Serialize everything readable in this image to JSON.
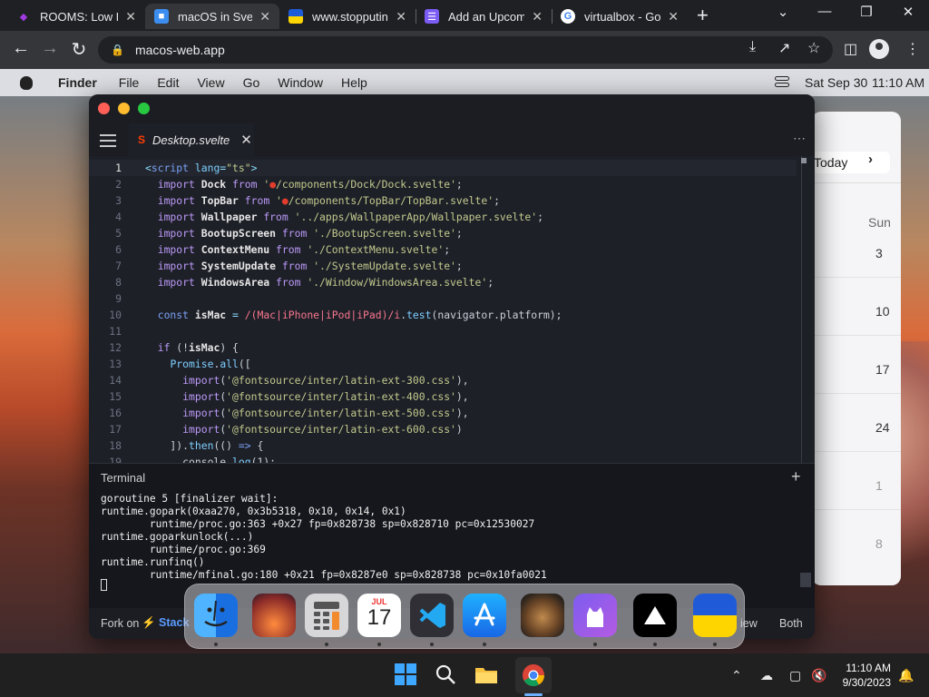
{
  "browser": {
    "tabs": [
      {
        "title": "ROOMS: Low De",
        "favicon": "rooms-icon",
        "color": "#a03be0"
      },
      {
        "title": "macOS in Svelte",
        "favicon": "vscode-file-icon",
        "color": "#3b8ef0"
      },
      {
        "title": "www.stopputin.",
        "favicon": "ukraine-icon",
        "color": "#ffd500"
      },
      {
        "title": "Add an Upcomi",
        "favicon": "form-icon",
        "color": "#7b5cf5"
      },
      {
        "title": "virtualbox - Goo",
        "favicon": "google-icon",
        "color": "#4285f4"
      }
    ],
    "url": "macos-web.app"
  },
  "macos": {
    "menubar": {
      "app": "Finder",
      "items": [
        "File",
        "Edit",
        "View",
        "Go",
        "Window",
        "Help"
      ],
      "date": "Sat Sep 30",
      "time": "11:10 AM"
    },
    "calendar": {
      "today_label": "Today",
      "day_header": "Sun",
      "dates": [
        "3",
        "10",
        "17",
        "24",
        "1",
        "8"
      ]
    },
    "editor": {
      "tab_title": "Desktop.svelte",
      "terminal_title": "Terminal",
      "terminal_output": [
        "goroutine 5 [finalizer wait]:",
        "runtime.gopark(0xaa270, 0x3b5318, 0x10, 0x14, 0x1)",
        "        runtime/proc.go:363 +0x27 fp=0x828738 sp=0x828710 pc=0x12530027",
        "runtime.goparkunlock(...)",
        "        runtime/proc.go:369",
        "runtime.runfinq()",
        "        runtime/mfinal.go:180 +0x21 fp=0x8287e0 sp=0x828738 pc=0x10fa0021"
      ],
      "status": {
        "fork": "Fork on",
        "stack": "Stack",
        "view": "iew",
        "both": "Both"
      }
    },
    "dock": [
      "finder-icon",
      "launchpad-icon",
      "calculator-icon",
      "calendar-icon",
      "vscode-icon",
      "app-store-icon",
      "cat-photo-icon",
      "github-icon",
      "vercel-icon",
      "ukraine-flag-icon"
    ],
    "dock_calendar": {
      "month": "JUL",
      "day": "17"
    }
  },
  "taskbar": {
    "time": "11:10 AM",
    "date": "9/30/2023"
  }
}
